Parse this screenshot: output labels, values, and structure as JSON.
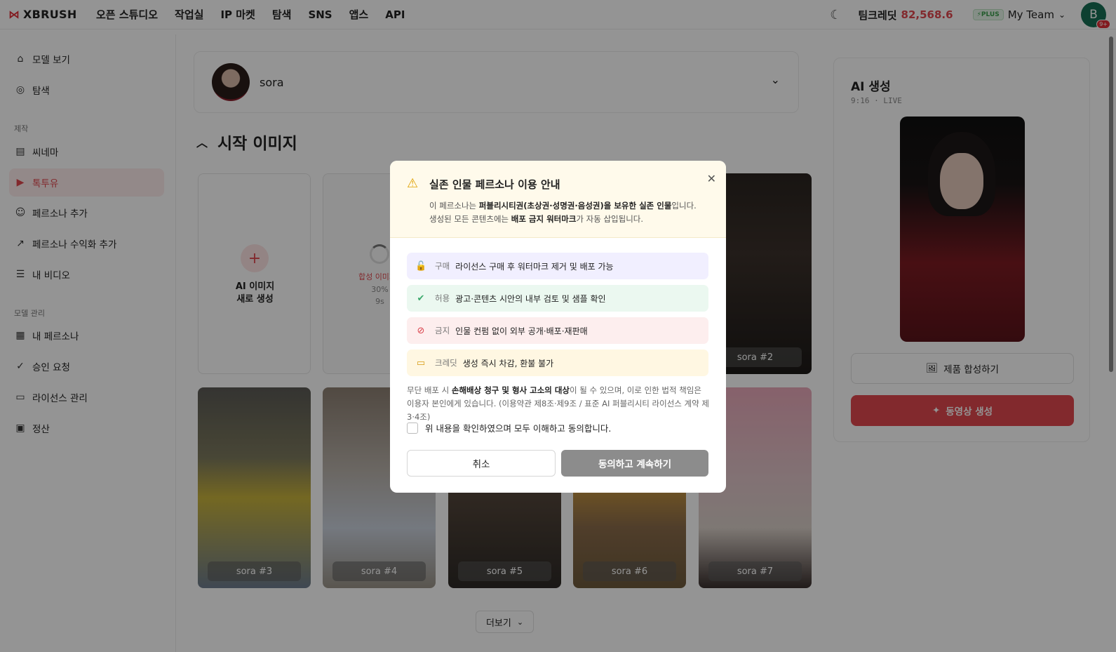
{
  "brand": {
    "logo_mark": "⋈",
    "name": "XBRUSH"
  },
  "nav": [
    "오픈 스튜디오",
    "작업실",
    "IP 마켓",
    "탐색",
    "SNS",
    "앱스",
    "API"
  ],
  "header": {
    "credit_label": "팀크레딧",
    "credit_value": "82,568.6",
    "plus_badge": "⚡PLUS",
    "team_name": "My Team",
    "avatar_letter": "B",
    "avatar_badge": "9+"
  },
  "sidebar": {
    "items_top": [
      {
        "label": "모델 보기",
        "icon": "store-icon"
      },
      {
        "label": "탐색",
        "icon": "compass-icon"
      }
    ],
    "section_make": "제작",
    "items_make": [
      {
        "label": "씨네마",
        "icon": "clapper-icon"
      },
      {
        "label": "톡투유",
        "icon": "play-square-icon",
        "active": true
      },
      {
        "label": "페르소나 추가",
        "icon": "user-plus-icon"
      },
      {
        "label": "페르소나 수익화 추가",
        "icon": "trend-up-icon"
      },
      {
        "label": "내 비디오",
        "icon": "video-list-icon"
      }
    ],
    "section_manage": "모델 관리",
    "items_manage": [
      {
        "label": "내 페르소나",
        "icon": "grid-icon"
      },
      {
        "label": "승인 요청",
        "icon": "file-check-icon"
      },
      {
        "label": "라이선스 관리",
        "icon": "document-icon"
      },
      {
        "label": "정산",
        "icon": "wallet-icon"
      }
    ]
  },
  "persona": {
    "name": "sora"
  },
  "section_title": "시작 이미지",
  "new_image": {
    "line1": "AI 이미지",
    "line2": "새로 생성"
  },
  "generating": {
    "label": "합성 이미지 ·",
    "percent": "30%",
    "time": "9s"
  },
  "cards": [
    "sora #2",
    "sora #3",
    "sora #4",
    "sora #5",
    "sora #6",
    "sora #7"
  ],
  "more_label": "더보기",
  "right_panel": {
    "title": "AI 생성",
    "sub": "9:16 · LIVE",
    "product_btn": "제품 합성하기",
    "video_btn": "동영상 생성"
  },
  "modal": {
    "title": "실존 인물 페르소나 이용 안내",
    "desc1_pre": "이 페르소나는 ",
    "desc1_bold": "퍼블리시티권(초상권·성명권·음성권)을 보유한 실존 인물",
    "desc1_post": "입니다.",
    "desc2_pre": "생성된 모든 콘텐츠에는 ",
    "desc2_bold": "배포 금지 워터마크",
    "desc2_post": "가 자동 삽입됩니다.",
    "rules": [
      {
        "tag": "구매",
        "text": "라이선스 구매 후 워터마크 제거 및 배포 가능",
        "color": "purple",
        "icon": "unlock-icon"
      },
      {
        "tag": "허용",
        "text": "광고·콘텐츠 시안의 내부 검토 및 샘플 확인",
        "color": "green",
        "icon": "check-circle-icon"
      },
      {
        "tag": "금지",
        "text": "인물 컨펌 없이 외부 공개·배포·재판매",
        "color": "red",
        "icon": "ban-icon"
      },
      {
        "tag": "크레딧",
        "text": "생성 즉시 차감, 환불 불가",
        "color": "yellow",
        "icon": "card-icon"
      }
    ],
    "legal_pre": "무단 배포 시 ",
    "legal_bold": "손해배상 청구 및 형사 고소의 대상",
    "legal_post": "이 될 수 있으며, 이로 인한 법적 책임은 이용자 본인에게 있습니다. (이용약관 제8조·제9조 / 표준 AI 퍼블리시티 라이선스 계약 제3·4조)",
    "checkbox_label": "위 내용을 확인하였으며 모두 이해하고 동의합니다.",
    "cancel": "취소",
    "agree": "동의하고 계속하기"
  }
}
